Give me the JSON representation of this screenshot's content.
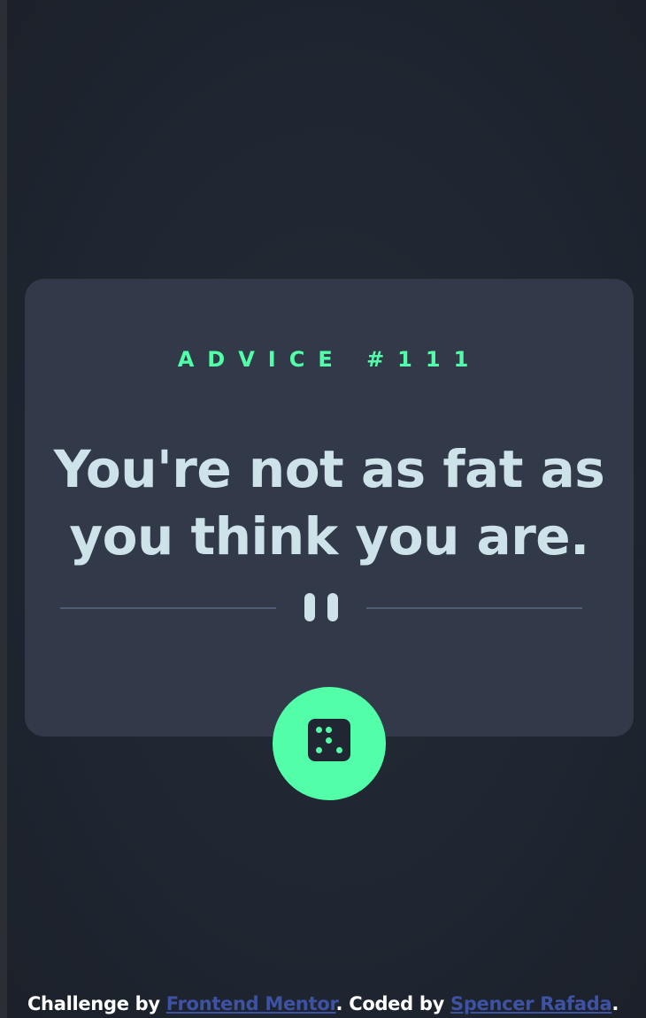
{
  "advice": {
    "id_label": "ADVICE #111",
    "quote": "You're not as fat as you think you are."
  },
  "icons": {
    "divider": "pause-icon",
    "dice": "dice-icon"
  },
  "footer": {
    "prefix": "Challenge by ",
    "link1": "Frontend Mentor",
    "middle": ". Coded by ",
    "link2": "Spencer Rafada",
    "suffix": "."
  },
  "colors": {
    "background": "#1f2631",
    "card": "#323a49",
    "accent": "#52ffa8",
    "quote_text": "#cee3e9",
    "divider": "#4f5d74",
    "link": "#3e52a3"
  }
}
